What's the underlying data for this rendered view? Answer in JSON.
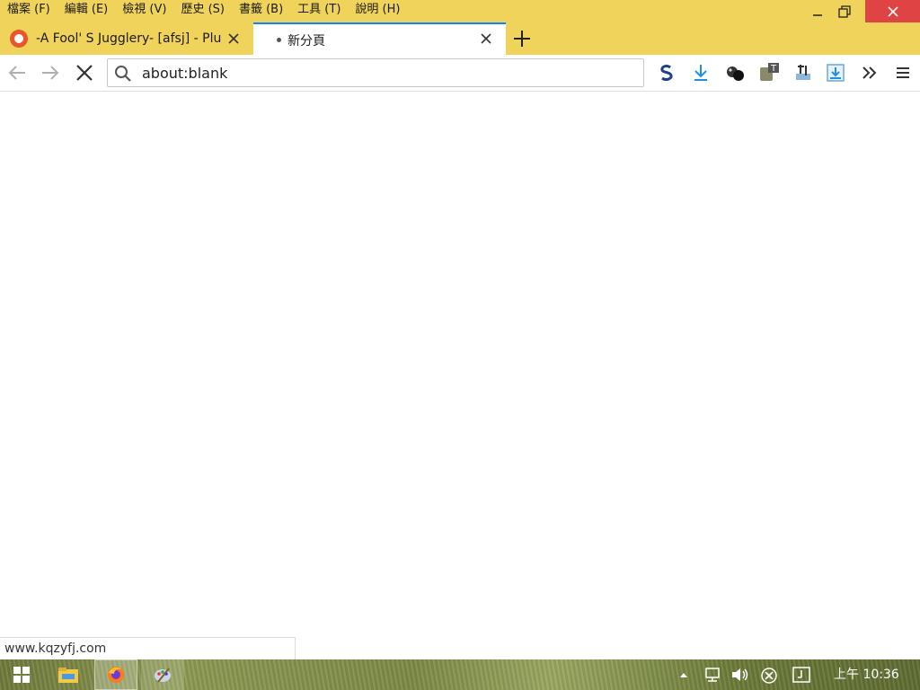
{
  "menu": [
    "檔案 (F)",
    "編輯 (E)",
    "檢視 (V)",
    "歷史 (S)",
    "書籤 (B)",
    "工具 (T)",
    "說明 (H)"
  ],
  "tabs": [
    {
      "title": "-A Fool' S Jugglery- [afsj] - Plu",
      "favicon": "favicon-icon"
    },
    {
      "title": "新分頁",
      "favicon": "loading-dot-icon"
    }
  ],
  "urlbar": {
    "value": "about:blank"
  },
  "status_text": "www.kqzyfj.com",
  "clock": "上午 10:36",
  "colors": {
    "accent": "#0a84ff",
    "titlebar": "#f0d35a",
    "close": "#e04343"
  }
}
